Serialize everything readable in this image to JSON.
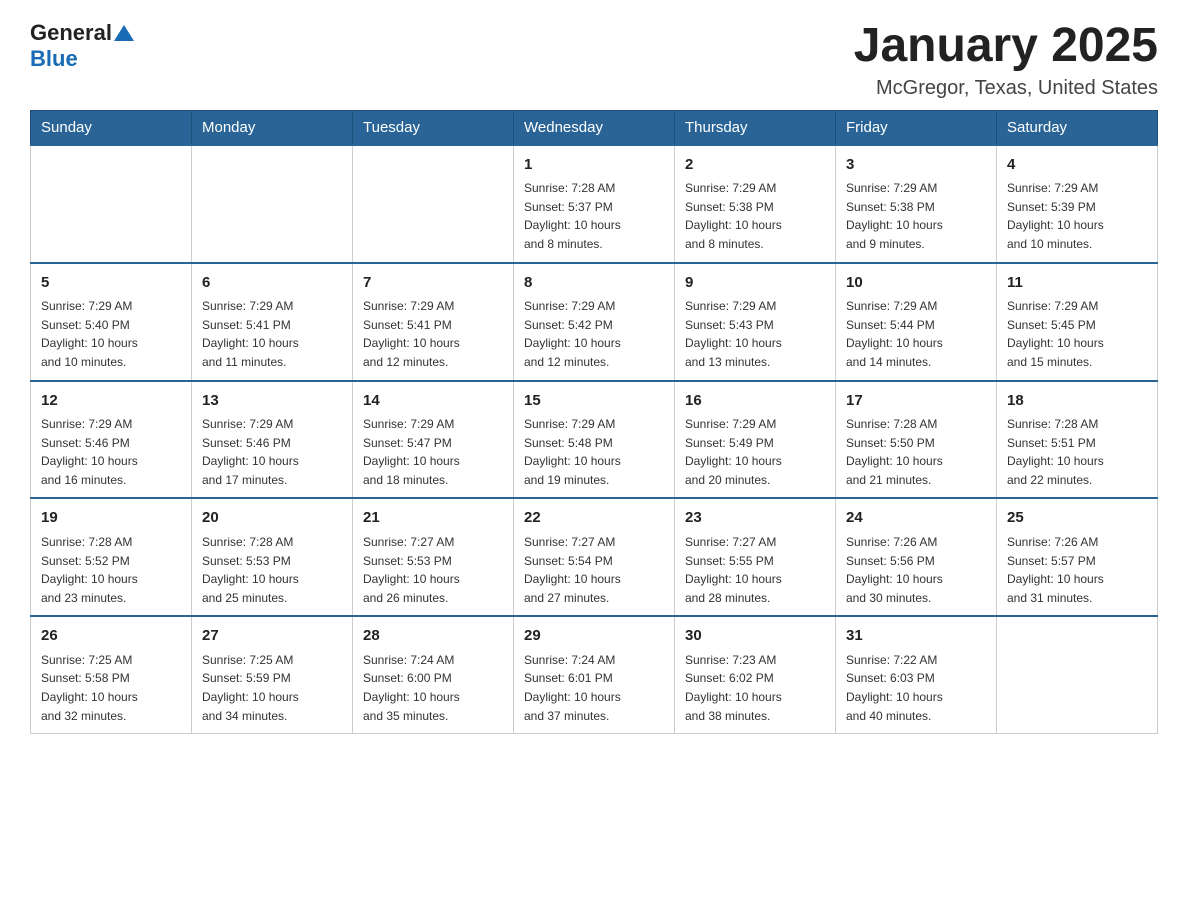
{
  "header": {
    "logo_general": "General",
    "logo_blue": "Blue",
    "title": "January 2025",
    "subtitle": "McGregor, Texas, United States"
  },
  "weekdays": [
    "Sunday",
    "Monday",
    "Tuesday",
    "Wednesday",
    "Thursday",
    "Friday",
    "Saturday"
  ],
  "weeks": [
    [
      {
        "day": "",
        "info": ""
      },
      {
        "day": "",
        "info": ""
      },
      {
        "day": "",
        "info": ""
      },
      {
        "day": "1",
        "info": "Sunrise: 7:28 AM\nSunset: 5:37 PM\nDaylight: 10 hours\nand 8 minutes."
      },
      {
        "day": "2",
        "info": "Sunrise: 7:29 AM\nSunset: 5:38 PM\nDaylight: 10 hours\nand 8 minutes."
      },
      {
        "day": "3",
        "info": "Sunrise: 7:29 AM\nSunset: 5:38 PM\nDaylight: 10 hours\nand 9 minutes."
      },
      {
        "day": "4",
        "info": "Sunrise: 7:29 AM\nSunset: 5:39 PM\nDaylight: 10 hours\nand 10 minutes."
      }
    ],
    [
      {
        "day": "5",
        "info": "Sunrise: 7:29 AM\nSunset: 5:40 PM\nDaylight: 10 hours\nand 10 minutes."
      },
      {
        "day": "6",
        "info": "Sunrise: 7:29 AM\nSunset: 5:41 PM\nDaylight: 10 hours\nand 11 minutes."
      },
      {
        "day": "7",
        "info": "Sunrise: 7:29 AM\nSunset: 5:41 PM\nDaylight: 10 hours\nand 12 minutes."
      },
      {
        "day": "8",
        "info": "Sunrise: 7:29 AM\nSunset: 5:42 PM\nDaylight: 10 hours\nand 12 minutes."
      },
      {
        "day": "9",
        "info": "Sunrise: 7:29 AM\nSunset: 5:43 PM\nDaylight: 10 hours\nand 13 minutes."
      },
      {
        "day": "10",
        "info": "Sunrise: 7:29 AM\nSunset: 5:44 PM\nDaylight: 10 hours\nand 14 minutes."
      },
      {
        "day": "11",
        "info": "Sunrise: 7:29 AM\nSunset: 5:45 PM\nDaylight: 10 hours\nand 15 minutes."
      }
    ],
    [
      {
        "day": "12",
        "info": "Sunrise: 7:29 AM\nSunset: 5:46 PM\nDaylight: 10 hours\nand 16 minutes."
      },
      {
        "day": "13",
        "info": "Sunrise: 7:29 AM\nSunset: 5:46 PM\nDaylight: 10 hours\nand 17 minutes."
      },
      {
        "day": "14",
        "info": "Sunrise: 7:29 AM\nSunset: 5:47 PM\nDaylight: 10 hours\nand 18 minutes."
      },
      {
        "day": "15",
        "info": "Sunrise: 7:29 AM\nSunset: 5:48 PM\nDaylight: 10 hours\nand 19 minutes."
      },
      {
        "day": "16",
        "info": "Sunrise: 7:29 AM\nSunset: 5:49 PM\nDaylight: 10 hours\nand 20 minutes."
      },
      {
        "day": "17",
        "info": "Sunrise: 7:28 AM\nSunset: 5:50 PM\nDaylight: 10 hours\nand 21 minutes."
      },
      {
        "day": "18",
        "info": "Sunrise: 7:28 AM\nSunset: 5:51 PM\nDaylight: 10 hours\nand 22 minutes."
      }
    ],
    [
      {
        "day": "19",
        "info": "Sunrise: 7:28 AM\nSunset: 5:52 PM\nDaylight: 10 hours\nand 23 minutes."
      },
      {
        "day": "20",
        "info": "Sunrise: 7:28 AM\nSunset: 5:53 PM\nDaylight: 10 hours\nand 25 minutes."
      },
      {
        "day": "21",
        "info": "Sunrise: 7:27 AM\nSunset: 5:53 PM\nDaylight: 10 hours\nand 26 minutes."
      },
      {
        "day": "22",
        "info": "Sunrise: 7:27 AM\nSunset: 5:54 PM\nDaylight: 10 hours\nand 27 minutes."
      },
      {
        "day": "23",
        "info": "Sunrise: 7:27 AM\nSunset: 5:55 PM\nDaylight: 10 hours\nand 28 minutes."
      },
      {
        "day": "24",
        "info": "Sunrise: 7:26 AM\nSunset: 5:56 PM\nDaylight: 10 hours\nand 30 minutes."
      },
      {
        "day": "25",
        "info": "Sunrise: 7:26 AM\nSunset: 5:57 PM\nDaylight: 10 hours\nand 31 minutes."
      }
    ],
    [
      {
        "day": "26",
        "info": "Sunrise: 7:25 AM\nSunset: 5:58 PM\nDaylight: 10 hours\nand 32 minutes."
      },
      {
        "day": "27",
        "info": "Sunrise: 7:25 AM\nSunset: 5:59 PM\nDaylight: 10 hours\nand 34 minutes."
      },
      {
        "day": "28",
        "info": "Sunrise: 7:24 AM\nSunset: 6:00 PM\nDaylight: 10 hours\nand 35 minutes."
      },
      {
        "day": "29",
        "info": "Sunrise: 7:24 AM\nSunset: 6:01 PM\nDaylight: 10 hours\nand 37 minutes."
      },
      {
        "day": "30",
        "info": "Sunrise: 7:23 AM\nSunset: 6:02 PM\nDaylight: 10 hours\nand 38 minutes."
      },
      {
        "day": "31",
        "info": "Sunrise: 7:22 AM\nSunset: 6:03 PM\nDaylight: 10 hours\nand 40 minutes."
      },
      {
        "day": "",
        "info": ""
      }
    ]
  ]
}
